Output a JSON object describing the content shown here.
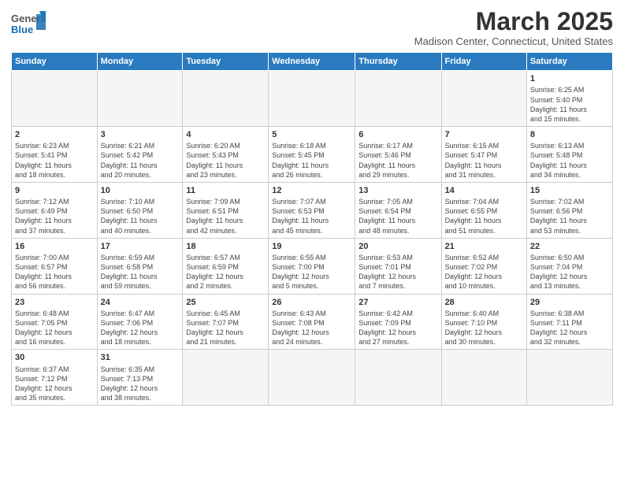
{
  "header": {
    "logo_general": "General",
    "logo_blue": "Blue",
    "month_title": "March 2025",
    "location": "Madison Center, Connecticut, United States"
  },
  "weekdays": [
    "Sunday",
    "Monday",
    "Tuesday",
    "Wednesday",
    "Thursday",
    "Friday",
    "Saturday"
  ],
  "weeks": [
    [
      {
        "day": "",
        "info": ""
      },
      {
        "day": "",
        "info": ""
      },
      {
        "day": "",
        "info": ""
      },
      {
        "day": "",
        "info": ""
      },
      {
        "day": "",
        "info": ""
      },
      {
        "day": "",
        "info": ""
      },
      {
        "day": "1",
        "info": "Sunrise: 6:25 AM\nSunset: 5:40 PM\nDaylight: 11 hours\nand 15 minutes."
      }
    ],
    [
      {
        "day": "2",
        "info": "Sunrise: 6:23 AM\nSunset: 5:41 PM\nDaylight: 11 hours\nand 18 minutes."
      },
      {
        "day": "3",
        "info": "Sunrise: 6:21 AM\nSunset: 5:42 PM\nDaylight: 11 hours\nand 20 minutes."
      },
      {
        "day": "4",
        "info": "Sunrise: 6:20 AM\nSunset: 5:43 PM\nDaylight: 11 hours\nand 23 minutes."
      },
      {
        "day": "5",
        "info": "Sunrise: 6:18 AM\nSunset: 5:45 PM\nDaylight: 11 hours\nand 26 minutes."
      },
      {
        "day": "6",
        "info": "Sunrise: 6:17 AM\nSunset: 5:46 PM\nDaylight: 11 hours\nand 29 minutes."
      },
      {
        "day": "7",
        "info": "Sunrise: 6:15 AM\nSunset: 5:47 PM\nDaylight: 11 hours\nand 31 minutes."
      },
      {
        "day": "8",
        "info": "Sunrise: 6:13 AM\nSunset: 5:48 PM\nDaylight: 11 hours\nand 34 minutes."
      }
    ],
    [
      {
        "day": "9",
        "info": "Sunrise: 7:12 AM\nSunset: 6:49 PM\nDaylight: 11 hours\nand 37 minutes."
      },
      {
        "day": "10",
        "info": "Sunrise: 7:10 AM\nSunset: 6:50 PM\nDaylight: 11 hours\nand 40 minutes."
      },
      {
        "day": "11",
        "info": "Sunrise: 7:09 AM\nSunset: 6:51 PM\nDaylight: 11 hours\nand 42 minutes."
      },
      {
        "day": "12",
        "info": "Sunrise: 7:07 AM\nSunset: 6:53 PM\nDaylight: 11 hours\nand 45 minutes."
      },
      {
        "day": "13",
        "info": "Sunrise: 7:05 AM\nSunset: 6:54 PM\nDaylight: 11 hours\nand 48 minutes."
      },
      {
        "day": "14",
        "info": "Sunrise: 7:04 AM\nSunset: 6:55 PM\nDaylight: 11 hours\nand 51 minutes."
      },
      {
        "day": "15",
        "info": "Sunrise: 7:02 AM\nSunset: 6:56 PM\nDaylight: 11 hours\nand 53 minutes."
      }
    ],
    [
      {
        "day": "16",
        "info": "Sunrise: 7:00 AM\nSunset: 6:57 PM\nDaylight: 11 hours\nand 56 minutes."
      },
      {
        "day": "17",
        "info": "Sunrise: 6:59 AM\nSunset: 6:58 PM\nDaylight: 11 hours\nand 59 minutes."
      },
      {
        "day": "18",
        "info": "Sunrise: 6:57 AM\nSunset: 6:59 PM\nDaylight: 12 hours\nand 2 minutes."
      },
      {
        "day": "19",
        "info": "Sunrise: 6:55 AM\nSunset: 7:00 PM\nDaylight: 12 hours\nand 5 minutes."
      },
      {
        "day": "20",
        "info": "Sunrise: 6:53 AM\nSunset: 7:01 PM\nDaylight: 12 hours\nand 7 minutes."
      },
      {
        "day": "21",
        "info": "Sunrise: 6:52 AM\nSunset: 7:02 PM\nDaylight: 12 hours\nand 10 minutes."
      },
      {
        "day": "22",
        "info": "Sunrise: 6:50 AM\nSunset: 7:04 PM\nDaylight: 12 hours\nand 13 minutes."
      }
    ],
    [
      {
        "day": "23",
        "info": "Sunrise: 6:48 AM\nSunset: 7:05 PM\nDaylight: 12 hours\nand 16 minutes."
      },
      {
        "day": "24",
        "info": "Sunrise: 6:47 AM\nSunset: 7:06 PM\nDaylight: 12 hours\nand 18 minutes."
      },
      {
        "day": "25",
        "info": "Sunrise: 6:45 AM\nSunset: 7:07 PM\nDaylight: 12 hours\nand 21 minutes."
      },
      {
        "day": "26",
        "info": "Sunrise: 6:43 AM\nSunset: 7:08 PM\nDaylight: 12 hours\nand 24 minutes."
      },
      {
        "day": "27",
        "info": "Sunrise: 6:42 AM\nSunset: 7:09 PM\nDaylight: 12 hours\nand 27 minutes."
      },
      {
        "day": "28",
        "info": "Sunrise: 6:40 AM\nSunset: 7:10 PM\nDaylight: 12 hours\nand 30 minutes."
      },
      {
        "day": "29",
        "info": "Sunrise: 6:38 AM\nSunset: 7:11 PM\nDaylight: 12 hours\nand 32 minutes."
      }
    ],
    [
      {
        "day": "30",
        "info": "Sunrise: 6:37 AM\nSunset: 7:12 PM\nDaylight: 12 hours\nand 35 minutes."
      },
      {
        "day": "31",
        "info": "Sunrise: 6:35 AM\nSunset: 7:13 PM\nDaylight: 12 hours\nand 38 minutes."
      },
      {
        "day": "",
        "info": ""
      },
      {
        "day": "",
        "info": ""
      },
      {
        "day": "",
        "info": ""
      },
      {
        "day": "",
        "info": ""
      },
      {
        "day": "",
        "info": ""
      }
    ]
  ]
}
